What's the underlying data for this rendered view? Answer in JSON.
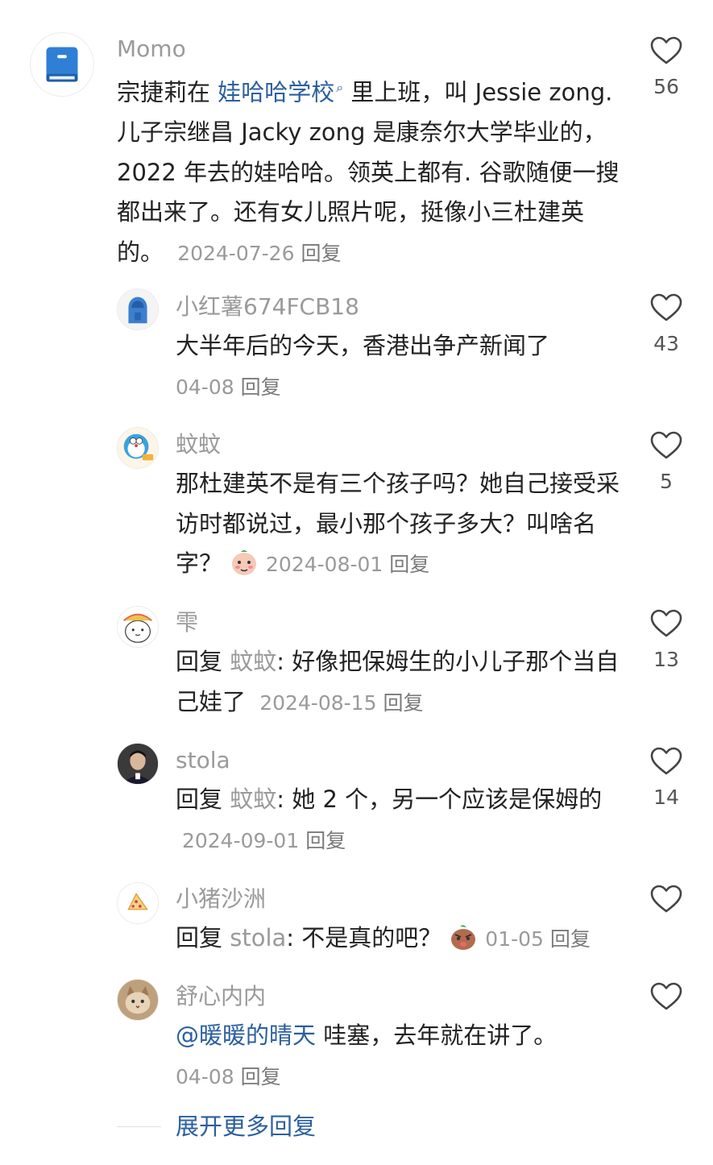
{
  "comments": [
    {
      "user": "Momo",
      "avatar": "blue-book-icon",
      "text_parts": [
        "宗捷莉在 ",
        "娃哈哈学校",
        " 里上班，叫 Jessie zong. 儿子宗继昌 Jacky zong 是康奈尔大学毕业的，2022 年去的娃哈哈。领英上都有. 谷歌随便一搜都出来了。还有女儿照片呢，挺像小三杜建英的。"
      ],
      "date": "2024-07-26",
      "reply_label": "回复",
      "likes": "56"
    },
    {
      "user": "小红薯674FCB18",
      "avatar": "blue-hoodie-avatar",
      "text": "大半年后的今天，香港出争产新闻了",
      "date": "04-08",
      "reply_label": "回复",
      "likes": "43"
    },
    {
      "user": "蚊蚊",
      "avatar": "doraemon-avatar",
      "text": "那杜建英不是有三个孩子吗？她自己接受采访时都说过，最小那个孩子多大？叫啥名字？",
      "emoji": "blushing-emoji",
      "date": "2024-08-01",
      "reply_label": "回复",
      "likes": "5"
    },
    {
      "user": "雫",
      "avatar": "white-bear-avatar",
      "reply_prefix": "回复",
      "reply_to": "蚊蚊",
      "text": ": 好像把保姆生的小儿子那个当自己娃了",
      "date": "2024-08-15",
      "reply_label": "回复",
      "likes": "13"
    },
    {
      "user": "stola",
      "avatar": "man-photo-avatar",
      "reply_prefix": "回复",
      "reply_to": "蚊蚊",
      "text": ": 她 2 个，另一个应该是保姆的",
      "date": "2024-09-01",
      "reply_label": "回复",
      "likes": "14"
    },
    {
      "user": "小猪沙洲",
      "avatar": "pizza-slice-avatar",
      "reply_prefix": "回复",
      "reply_to": "stola",
      "text": ": 不是真的吧？",
      "emoji": "angry-emoji",
      "date": "01-05",
      "reply_label": "回复",
      "likes": ""
    },
    {
      "user": "舒心内内",
      "avatar": "cat-photo-avatar",
      "mention": "@暖暖的晴天",
      "text": " 哇塞，去年就在讲了。",
      "date": "04-08",
      "reply_label": "回复",
      "likes": ""
    }
  ],
  "expand_more": "展开更多回复",
  "colors": {
    "link": "#2b5fa0",
    "muted": "#9a9a9a",
    "text": "#222222"
  }
}
